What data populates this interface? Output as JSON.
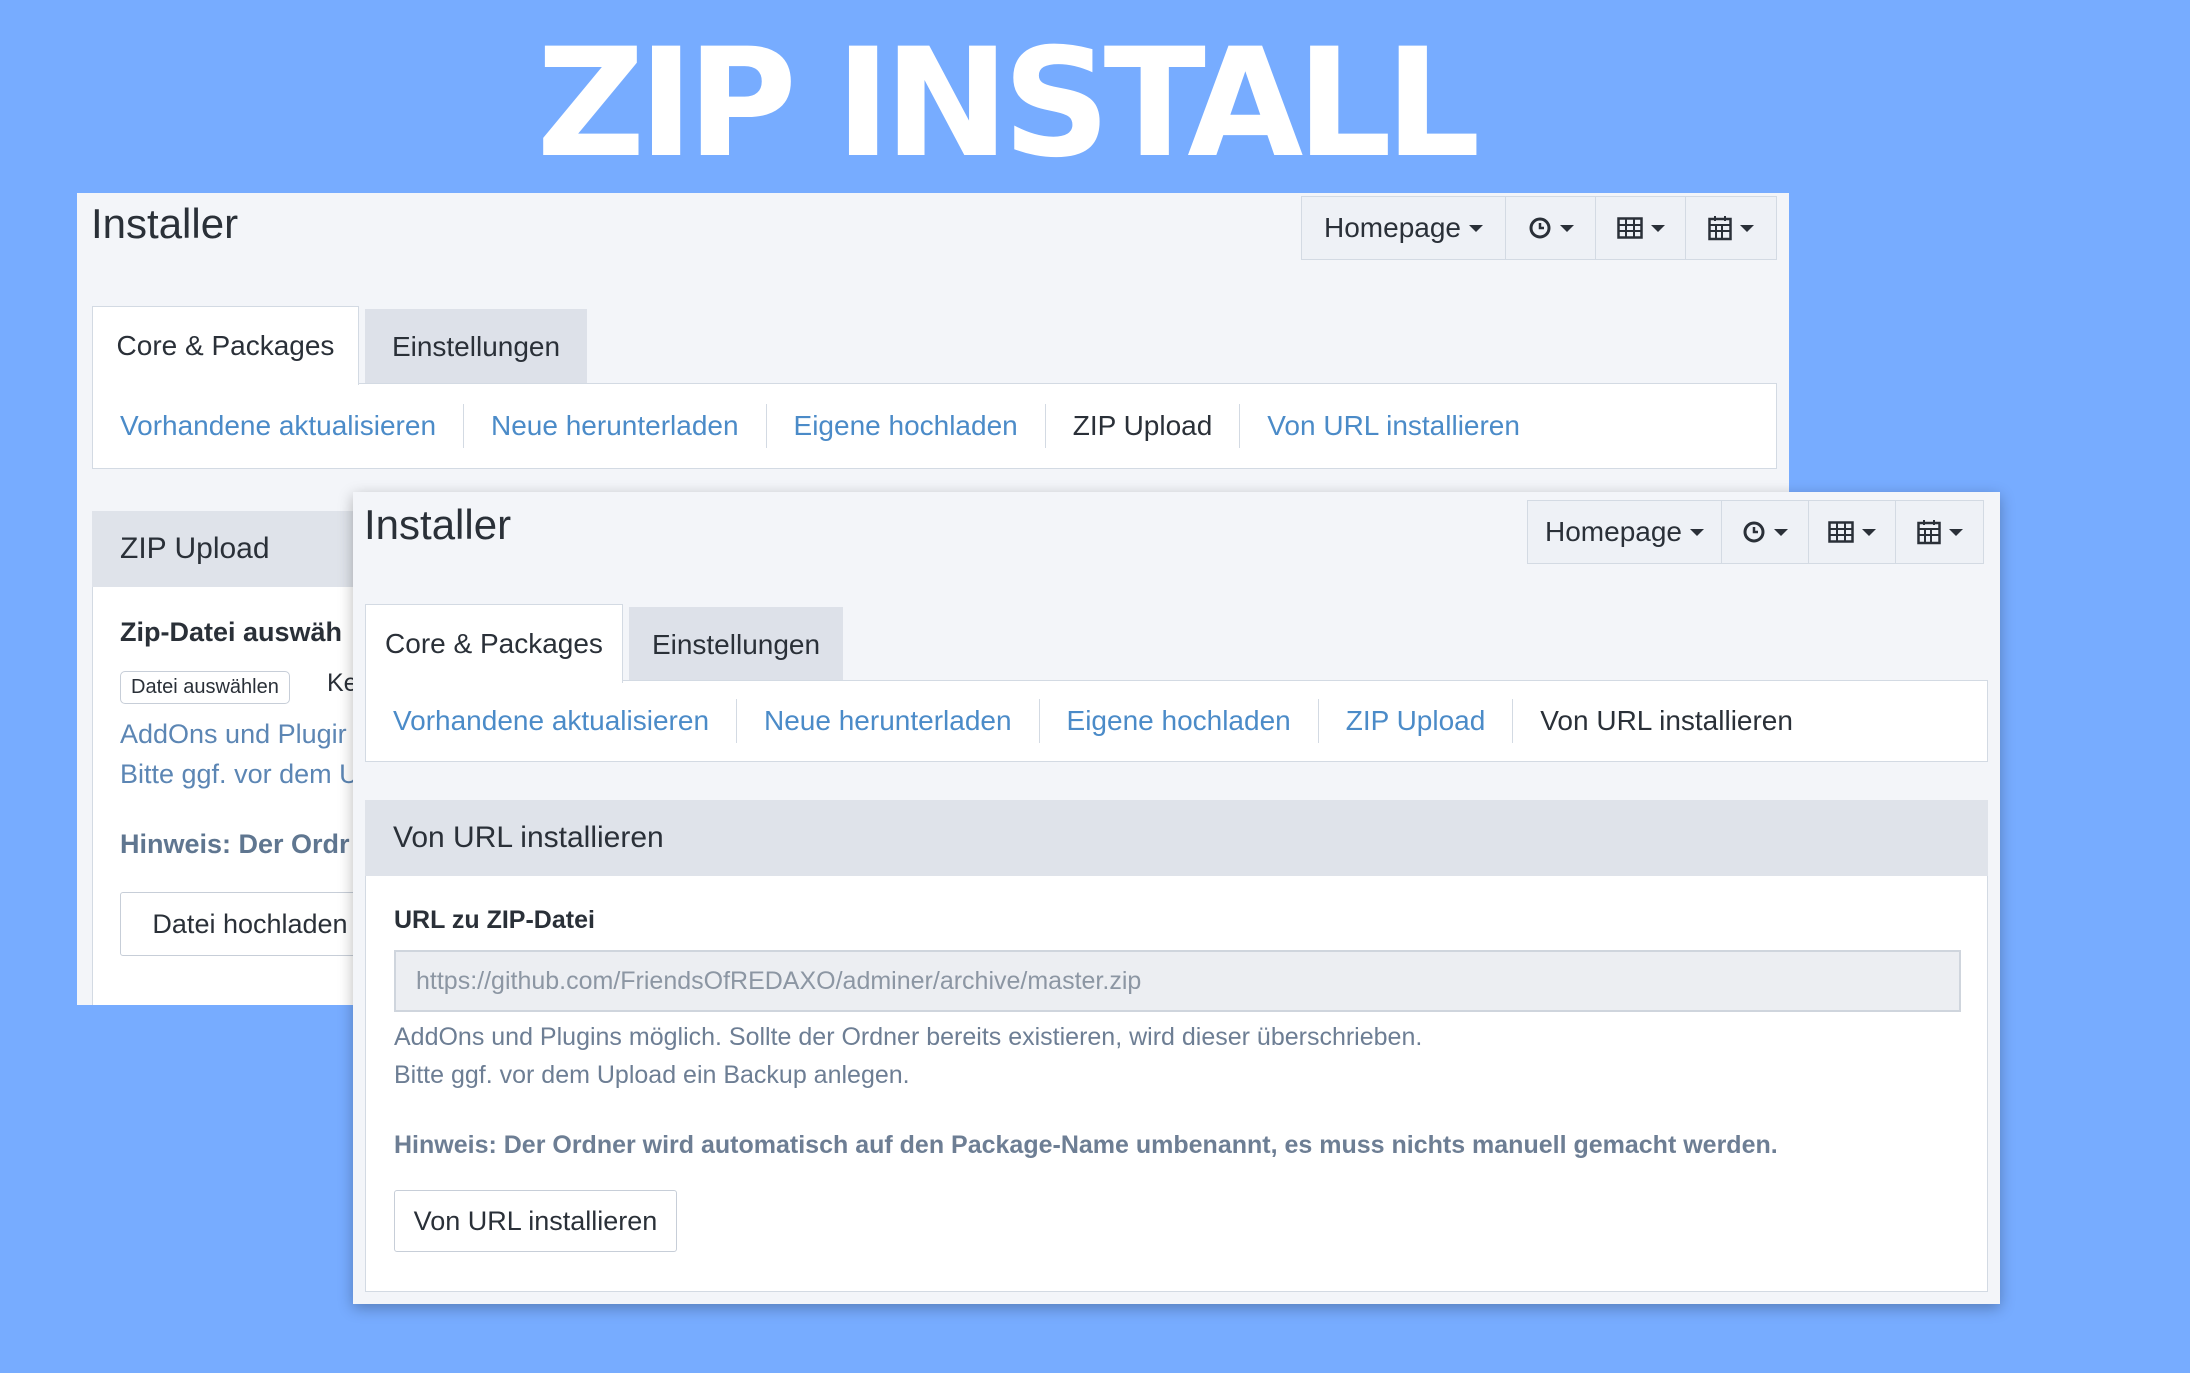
{
  "hero_title": "ZIP INSTALL",
  "back_window": {
    "title": "Installer",
    "toolbar": {
      "homepage_label": "Homepage",
      "clock_icon": "clock-icon",
      "table_icon": "table-icon",
      "calendar_icon": "calendar-icon"
    },
    "tabs": [
      {
        "label": "Core & Packages",
        "active": true
      },
      {
        "label": "Einstellungen",
        "active": false
      }
    ],
    "subnav": [
      {
        "label": "Vorhandene aktualisieren",
        "active": false
      },
      {
        "label": "Neue herunterladen",
        "active": false
      },
      {
        "label": "Eigene hochladen",
        "active": false
      },
      {
        "label": "ZIP Upload",
        "active": true
      },
      {
        "label": "Von URL installieren",
        "active": false
      }
    ],
    "panel": {
      "heading": "ZIP Upload",
      "field_label": "Zip-Datei auswäh",
      "file_button": "Datei auswählen",
      "file_status": "Kei",
      "help_line1": "AddOns und Plugir",
      "help_line2": "Bitte ggf. vor dem U",
      "hint": "Hinweis: Der Ordr",
      "submit_label": "Datei hochladen"
    }
  },
  "front_window": {
    "title": "Installer",
    "toolbar": {
      "homepage_label": "Homepage",
      "clock_icon": "clock-icon",
      "table_icon": "table-icon",
      "calendar_icon": "calendar-icon"
    },
    "tabs": [
      {
        "label": "Core & Packages",
        "active": true
      },
      {
        "label": "Einstellungen",
        "active": false
      }
    ],
    "subnav": [
      {
        "label": "Vorhandene aktualisieren",
        "active": false
      },
      {
        "label": "Neue herunterladen",
        "active": false
      },
      {
        "label": "Eigene hochladen",
        "active": false
      },
      {
        "label": "ZIP Upload",
        "active": false
      },
      {
        "label": "Von URL installieren",
        "active": true
      }
    ],
    "panel": {
      "heading": "Von URL installieren",
      "field_label": "URL zu ZIP-Datei",
      "url_placeholder": "https://github.com/FriendsOfREDAXO/adminer/archive/master.zip",
      "help_line1": "AddOns und Plugins möglich. Sollte der Ordner bereits existieren, wird dieser überschrieben.",
      "help_line2": "Bitte ggf. vor dem Upload ein Backup anlegen.",
      "hint": "Hinweis: Der Ordner wird automatisch auf den Package-Name umbenannt, es muss nichts manuell gemacht werden.",
      "submit_label": "Von URL installieren"
    }
  },
  "colors": {
    "background": "#77acff",
    "link": "#4b8bc8",
    "text": "#2a3038",
    "panel_heading_bg": "#dfe3ea"
  }
}
